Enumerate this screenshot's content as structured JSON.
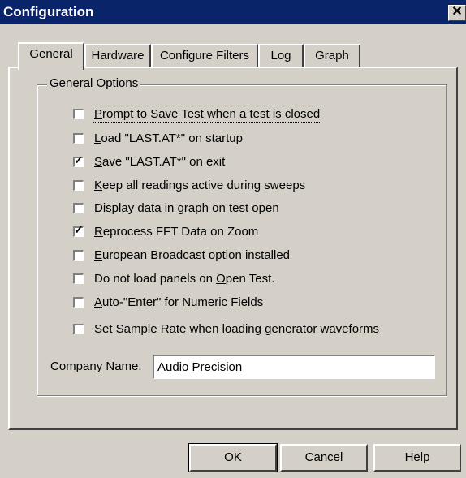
{
  "window": {
    "title": "Configuration",
    "close_glyph": "✕"
  },
  "tabs": [
    {
      "label": "General",
      "active": true
    },
    {
      "label": "Hardware",
      "active": false
    },
    {
      "label": "Configure Filters",
      "active": false
    },
    {
      "label": "Log",
      "active": false
    },
    {
      "label": "Graph",
      "active": false
    }
  ],
  "group": {
    "legend": "General Options"
  },
  "options": [
    {
      "pre": "",
      "u": "P",
      "post": "rompt to Save Test  when a test is closed",
      "checked": false
    },
    {
      "pre": "",
      "u": "L",
      "post": "oad \"LAST.AT*\" on startup",
      "checked": false
    },
    {
      "pre": "",
      "u": "S",
      "post": "ave \"LAST.AT*\" on exit",
      "checked": true
    },
    {
      "pre": "",
      "u": "K",
      "post": "eep all readings active during sweeps",
      "checked": false
    },
    {
      "pre": "",
      "u": "D",
      "post": "isplay data in graph on test open",
      "checked": false
    },
    {
      "pre": "",
      "u": "R",
      "post": "eprocess FFT Data on Zoom",
      "checked": true
    },
    {
      "pre": "",
      "u": "E",
      "post": "uropean Broadcast option installed",
      "checked": false
    },
    {
      "pre": "Do not load panels on ",
      "u": "O",
      "post": "pen Test.",
      "checked": false
    },
    {
      "pre": "",
      "u": "A",
      "post": "uto-\"Enter\" for Numeric Fields",
      "checked": false
    },
    {
      "pre": "Set Sample Rate when loading generator waveforms",
      "u": "",
      "post": "",
      "checked": false
    }
  ],
  "company": {
    "label": "Company Name:",
    "value": "Audio Precision"
  },
  "buttons": {
    "ok": "OK",
    "cancel": "Cancel",
    "help": "Help"
  },
  "check_glyph": "✓",
  "colors": {
    "face": "#d4d0c8",
    "titlebar": "#0a246a",
    "title_text": "#ffffff"
  }
}
